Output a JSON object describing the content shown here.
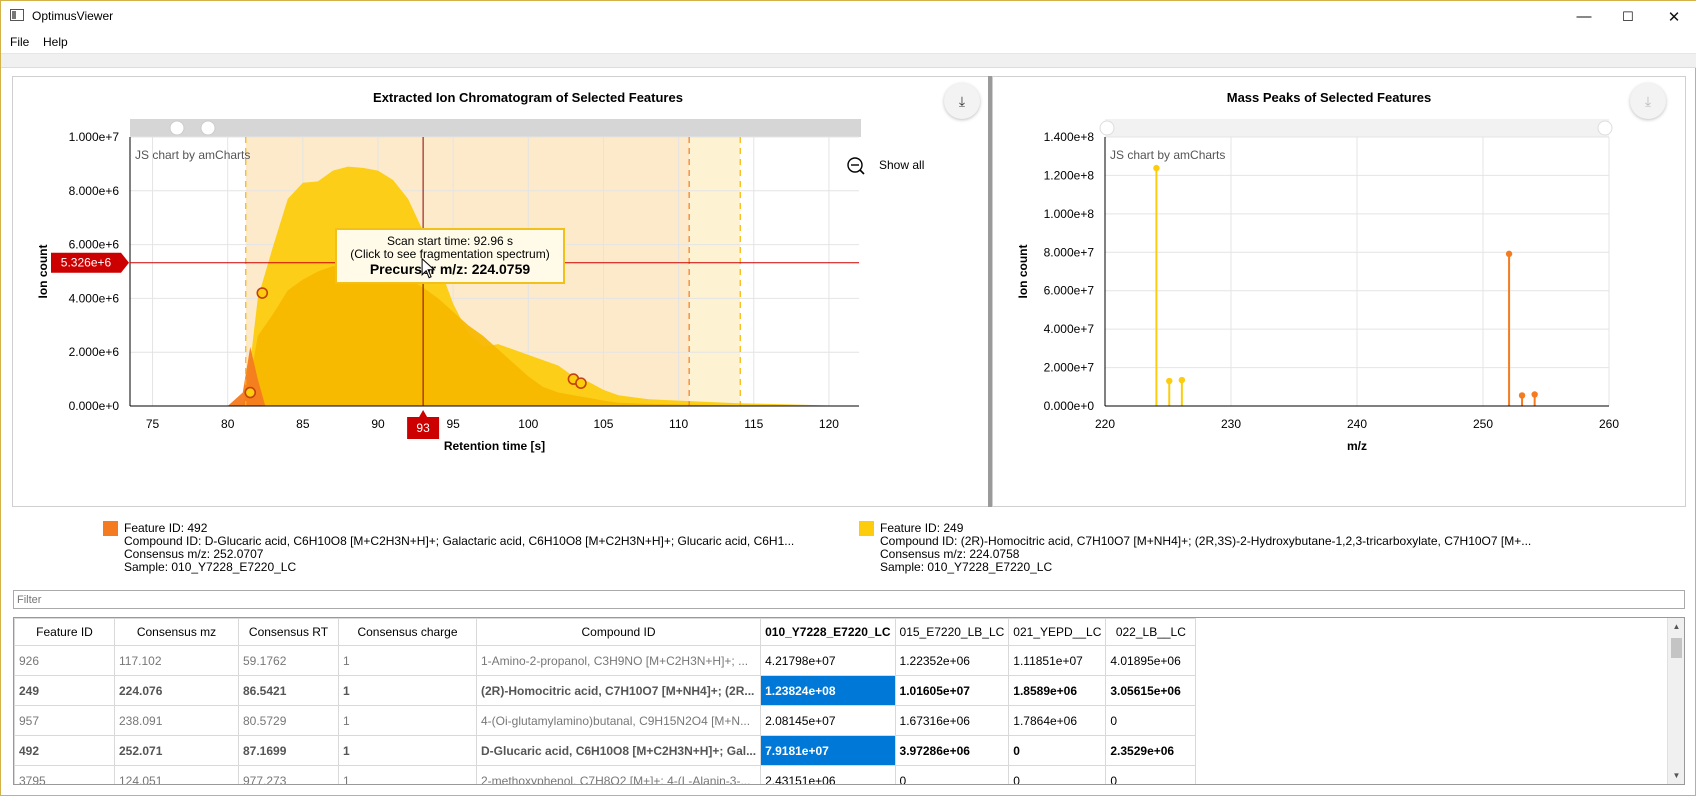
{
  "window": {
    "title": "OptimusViewer",
    "minimize": "—",
    "maximize": "☐",
    "close": "✕"
  },
  "menu": {
    "file": "File",
    "help": "Help"
  },
  "left_chart": {
    "title": "Extracted Ion Chromatogram of Selected Features",
    "credit": "JS chart by amCharts",
    "show_all": "Show all",
    "cursor_y_label": "5.326e+6",
    "cursor_x_label": "93",
    "tooltip": {
      "line1": "Scan start time: 92.96 s",
      "line2": "(Click to see fragmentation spectrum)",
      "line3": "Precursor m/z: 224.0759"
    }
  },
  "right_chart": {
    "title": "Mass Peaks of Selected Features",
    "credit": "JS chart by amCharts"
  },
  "chart_data": [
    {
      "type": "area",
      "title": "Extracted Ion Chromatogram of Selected Features",
      "xlabel": "Retention time [s]",
      "ylabel": "Ion count",
      "xlim": [
        73.5,
        122
      ],
      "ylim": [
        0,
        10000000
      ],
      "x_ticks": [
        "75",
        "80",
        "85",
        "90",
        "95",
        "100",
        "105",
        "110",
        "115",
        "120"
      ],
      "y_ticks": [
        "0.000e+0",
        "2.000e+6",
        "4.000e+6",
        "6.000e+6",
        "8.000e+6",
        "1.000e+7"
      ],
      "colors": {
        "feature_249": "#fccc0d",
        "feature_249_b": "#f8b700",
        "feature_492": "#f47b20"
      },
      "series": [
        {
          "x": [
            80,
            81,
            81.5,
            82,
            83,
            84,
            85,
            86,
            87,
            88,
            89,
            90,
            91,
            92,
            93,
            94,
            95,
            96,
            97,
            98,
            99,
            100,
            101,
            102,
            103,
            104,
            105,
            106,
            108,
            110,
            112,
            114,
            116,
            118,
            120,
            122
          ],
          "y": [
            0,
            100000,
            1600000,
            4000000,
            5900000,
            7700000,
            8300000,
            8350000,
            8750000,
            8900000,
            8850000,
            8750000,
            8400000,
            7700000,
            6500000,
            5300000,
            3800000,
            2700000,
            2200000,
            2300000,
            2100000,
            1900000,
            1700000,
            1500000,
            1100000,
            900000,
            600000,
            400000,
            250000,
            200000,
            150000,
            100000,
            80000,
            50000,
            20000,
            0
          ]
        },
        {
          "x": [
            80,
            81,
            81.5,
            82,
            83,
            84,
            85,
            86,
            87,
            88,
            89,
            90,
            91,
            92,
            93,
            94,
            95,
            96,
            97,
            98,
            99,
            100,
            101,
            102,
            103,
            104,
            105,
            106,
            108,
            110,
            112,
            114,
            116,
            118,
            120,
            122
          ],
          "y": [
            0,
            50000,
            1000000,
            2600000,
            3400000,
            4300000,
            4700000,
            5000000,
            5200000,
            5150000,
            5050000,
            4950000,
            4850000,
            4750000,
            4400000,
            4000000,
            3500000,
            3000000,
            2600000,
            2100000,
            1600000,
            1100000,
            700000,
            500000,
            400000,
            300000,
            200000,
            120000,
            80000,
            60000,
            40000,
            20000,
            10000,
            5000,
            0,
            0
          ]
        },
        {
          "x": [
            80,
            81,
            81.5,
            82,
            82.5,
            83
          ],
          "y": [
            0,
            500000,
            2200000,
            1000000,
            0,
            0
          ]
        }
      ],
      "markers": [
        {
          "x": 82.3,
          "y": 4200000
        },
        {
          "x": 81.5,
          "y": 500000
        },
        {
          "x": 103.0,
          "y": 1000000
        },
        {
          "x": 103.5,
          "y": 850000
        }
      ],
      "guides": [
        81.2,
        110.7,
        114.1
      ],
      "cursor": {
        "x": 93,
        "y": 5326000
      }
    },
    {
      "type": "bar",
      "title": "Mass Peaks of Selected Features",
      "xlabel": "m/z",
      "ylabel": "Ion count",
      "xlim": [
        220,
        260
      ],
      "ylim": [
        0,
        140000000
      ],
      "x_ticks": [
        "220",
        "230",
        "240",
        "250",
        "260"
      ],
      "y_ticks": [
        "0.000e+0",
        "2.000e+7",
        "4.000e+7",
        "6.000e+7",
        "8.000e+7",
        "1.000e+8",
        "1.200e+8",
        "1.400e+8"
      ],
      "series": [
        {
          "color": "#fccc0d",
          "x": [
            224.08,
            225.1,
            226.1
          ],
          "y": [
            123824000,
            13000000,
            13500000
          ]
        },
        {
          "color": "#f47b20",
          "x": [
            252.07,
            253.1,
            254.1
          ],
          "y": [
            79181000,
            5500000,
            6000000
          ]
        }
      ]
    }
  ],
  "legend": [
    {
      "color": "#f47b20",
      "feature": "Feature ID: 492",
      "compound": "Compound ID: D-Glucaric acid, C6H10O8 [M+C2H3N+H]+; Galactaric acid, C6H10O8 [M+C2H3N+H]+; Glucaric acid, C6H1...",
      "mz": "Consensus m/z: 252.0707",
      "sample": "Sample: 010_Y7228_E7220_LC"
    },
    {
      "color": "#fccc0d",
      "feature": "Feature ID: 249",
      "compound": "Compound ID: (2R)-Homocitric acid, C7H10O7 [M+NH4]+; (2R,3S)-2-Hydroxybutane-1,2,3-tricarboxylate, C7H10O7 [M+...",
      "mz": "Consensus m/z: 224.0758",
      "sample": "Sample: 010_Y7228_E7220_LC"
    }
  ],
  "filter": {
    "placeholder": "Filter"
  },
  "table": {
    "headers": [
      "Feature ID",
      "Consensus mz",
      "Consensus RT",
      "Consensus charge",
      "Compound ID",
      "010_Y7228_E7220_LC",
      "015_E7220_LB_LC",
      "021_YEPD__LC",
      "022_LB__LC"
    ],
    "rows": [
      {
        "bold": false,
        "cells": [
          "926",
          "117.102",
          "59.1762",
          "1",
          "1-Amino-2-propanol, C3H9NO [M+C2H3N+H]+; ...",
          "4.21798e+07",
          "1.22352e+06",
          "1.11851e+07",
          "4.01895e+06"
        ]
      },
      {
        "bold": true,
        "cells": [
          "249",
          "224.076",
          "86.5421",
          "1",
          "(2R)-Homocitric acid, C7H10O7 [M+NH4]+; (2R...",
          "1.23824e+08",
          "1.01605e+07",
          "1.8589e+06",
          "3.05615e+06"
        ]
      },
      {
        "bold": false,
        "cells": [
          "957",
          "238.091",
          "80.5729",
          "1",
          "4-(Oi-glutamylamino)butanal, C9H15N2O4 [M+N...",
          "2.08145e+07",
          "1.67316e+06",
          "1.7864e+06",
          "0"
        ]
      },
      {
        "bold": true,
        "cells": [
          "492",
          "252.071",
          "87.1699",
          "1",
          "D-Glucaric acid, C6H10O8 [M+C2H3N+H]+; Gal...",
          "7.9181e+07",
          "3.97286e+06",
          "0",
          "2.3529e+06"
        ]
      },
      {
        "bold": false,
        "cells": [
          "3795",
          "124.051",
          "977.273",
          "1",
          "2-methoxyphenol, C7H8O2 [M+]+; 4-(L-Alanin-3-...",
          "2.43151e+06",
          "0",
          "0",
          "0"
        ]
      }
    ]
  }
}
